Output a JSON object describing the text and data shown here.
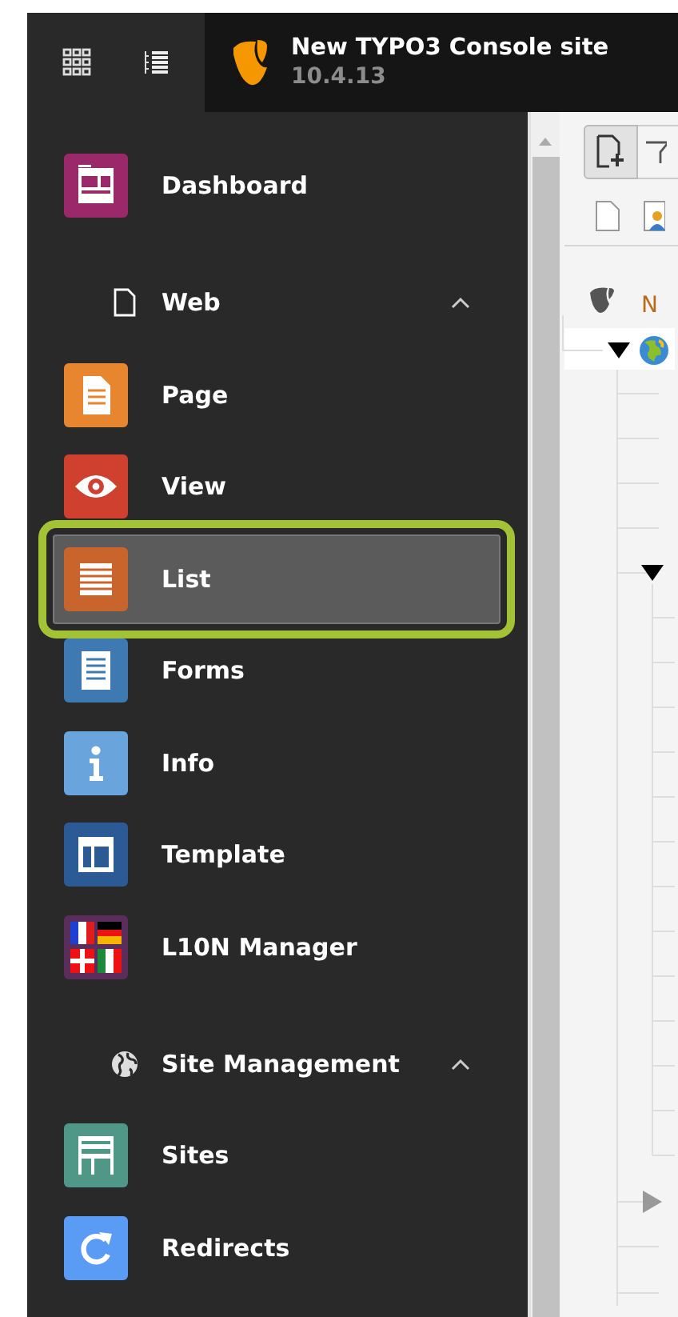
{
  "topbar": {
    "title": "New TYPO3 Console site",
    "version": "10.4.13"
  },
  "menu": [
    {
      "kind": "module",
      "label": "Dashboard",
      "color": "#9b2868",
      "selected": false
    },
    {
      "kind": "group",
      "label": "Web",
      "expanded": true,
      "children": [
        {
          "kind": "module",
          "label": "Page",
          "color": "#e8862f",
          "selected": false
        },
        {
          "kind": "module",
          "label": "View",
          "color": "#d0402f",
          "selected": false
        },
        {
          "kind": "module",
          "label": "List",
          "color": "#c9642d",
          "selected": true
        },
        {
          "kind": "module",
          "label": "Forms",
          "color": "#3f79b1",
          "selected": false
        },
        {
          "kind": "module",
          "label": "Info",
          "color": "#6aa4dd",
          "selected": false
        },
        {
          "kind": "module",
          "label": "Template",
          "color": "#2c5a94",
          "selected": false
        },
        {
          "kind": "module",
          "label": "L10N Manager",
          "color": "#5a2d5b",
          "selected": false
        }
      ]
    },
    {
      "kind": "group",
      "label": "Site Management",
      "expanded": true,
      "children": [
        {
          "kind": "module",
          "label": "Sites",
          "color": "#4f9887",
          "selected": false
        },
        {
          "kind": "module",
          "label": "Redirects",
          "color": "#5a9cf5",
          "selected": false
        }
      ]
    }
  ],
  "page_tree": {
    "root_label": "N"
  }
}
